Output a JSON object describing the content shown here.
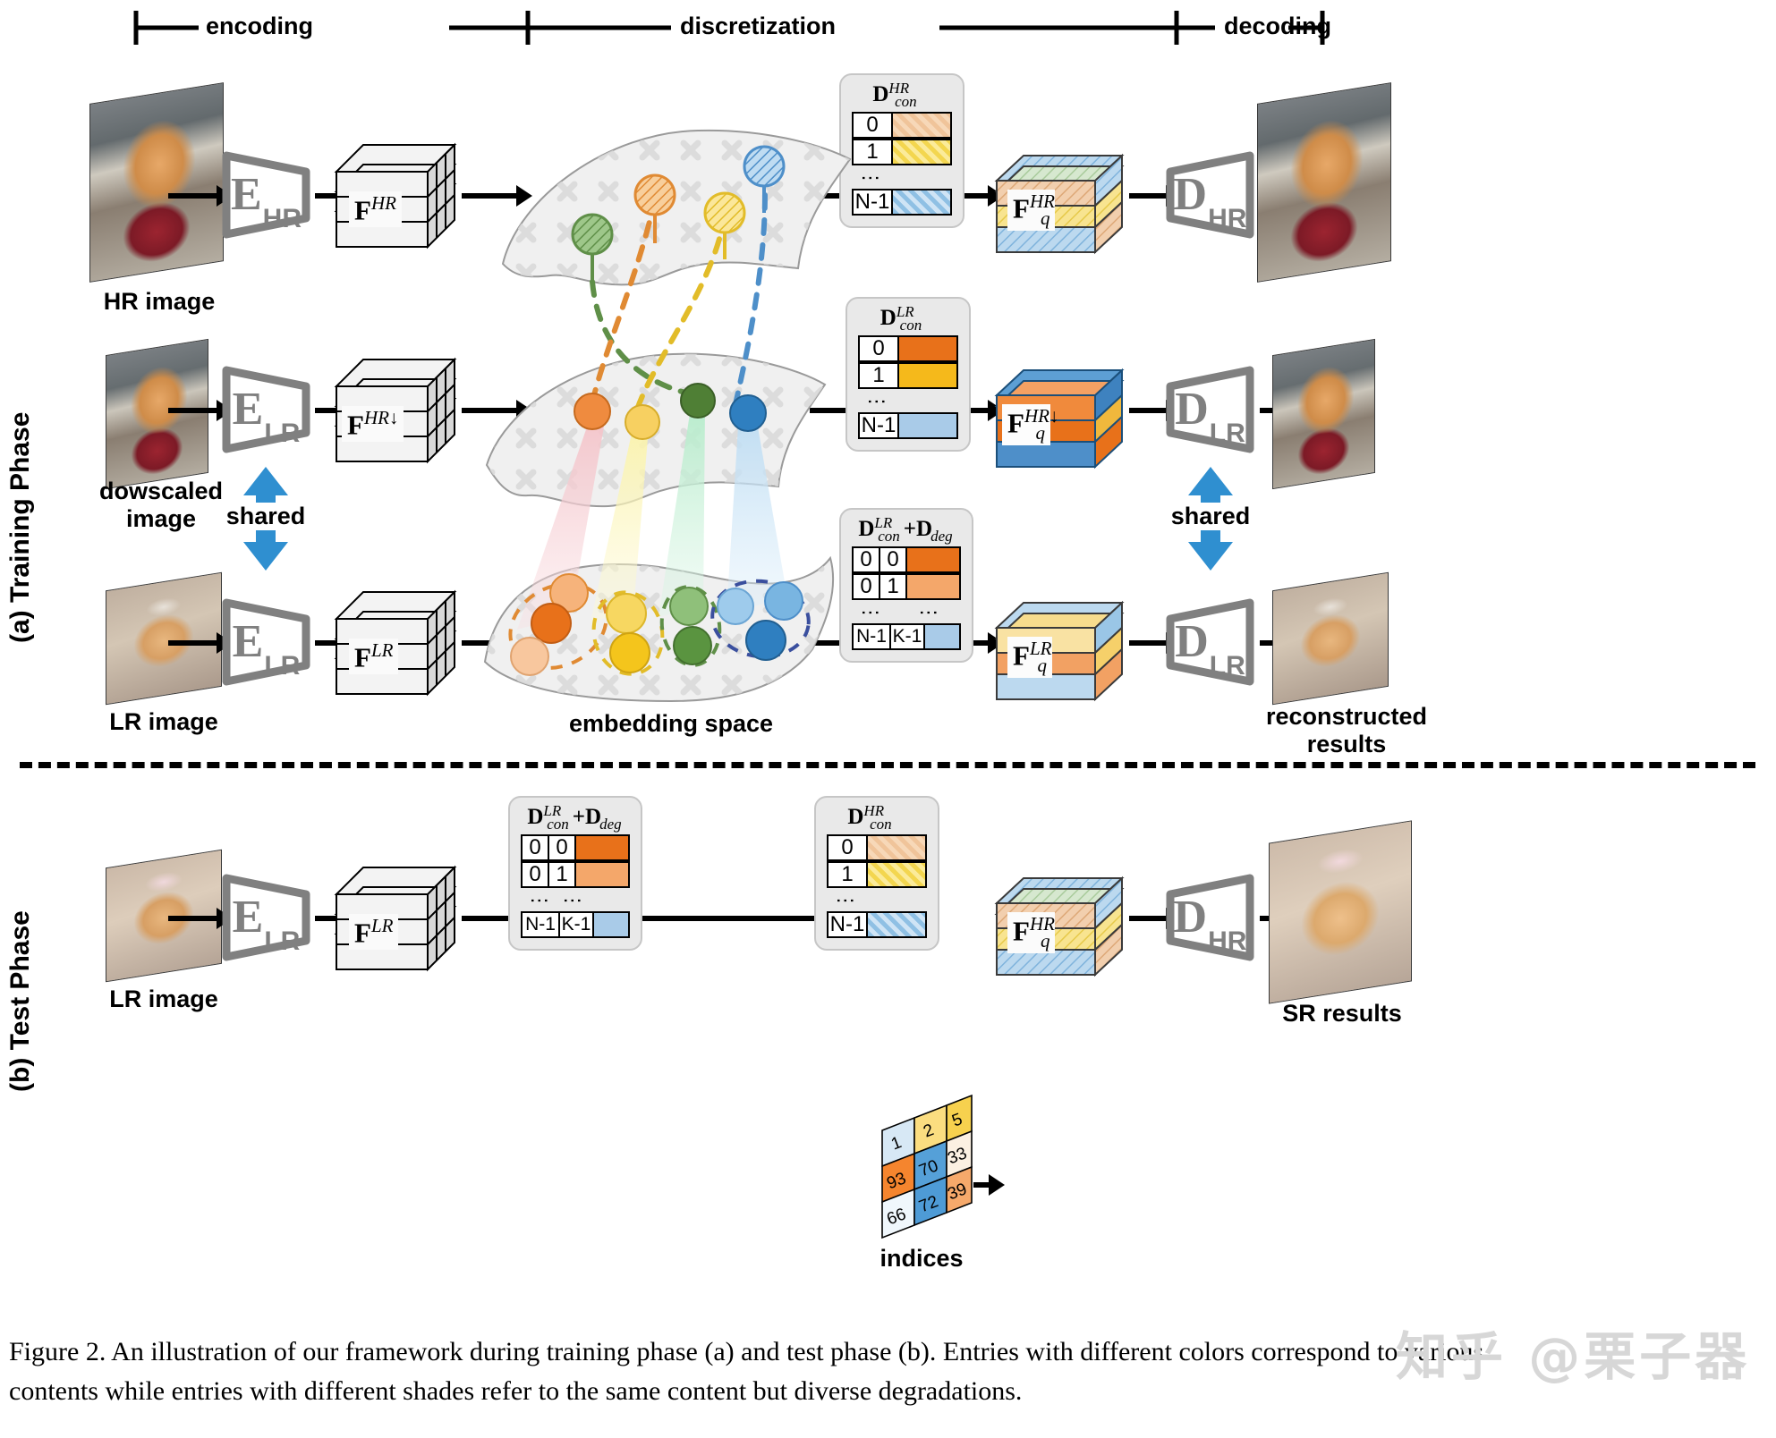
{
  "figure": {
    "caption_line1": "Figure 2. An illustration of our framework during training phase (a) and test phase (b). Entries with different colors correspond to various",
    "caption_line2": "contents while entries with different shades refer to the same content but diverse degradations.",
    "watermark": "知乎 @栗子器"
  },
  "stages": [
    {
      "label": "encoding"
    },
    {
      "label": "discretization"
    },
    {
      "label": "decoding"
    }
  ],
  "phases": [
    {
      "label": "(a) Training Phase"
    },
    {
      "label": "(b) Test Phase"
    }
  ],
  "training": {
    "rows": [
      {
        "input_label": "HR image",
        "encoder": {
          "main": "E",
          "sub": "HR"
        },
        "feature": {
          "base": "F",
          "sup": "HR",
          "sub": ""
        },
        "codebook": {
          "title_main": "D",
          "title_sup": "HR",
          "title_sub": "con",
          "columns": 1,
          "rows": [
            {
              "idx": [
                "0"
              ],
              "color": "#f0c49a",
              "hatched": true
            },
            {
              "idx": [
                "1"
              ],
              "color": "#f7dc63",
              "hatched": true
            }
          ],
          "last_row": {
            "idx": [
              "N-1"
            ],
            "color": "#a9cbe8",
            "hatched": true
          },
          "ellipsis": "⋮"
        },
        "quant_feature": {
          "base": "F",
          "sup": "HR",
          "sub": "q"
        },
        "decoder": {
          "main": "D",
          "sub": "HR"
        },
        "output_label": ""
      },
      {
        "input_label": "dowscaled\nimage",
        "encoder": {
          "main": "E",
          "sub": "LR"
        },
        "feature": {
          "base": "F",
          "sup": "HR↓",
          "sub": ""
        },
        "codebook": {
          "title_main": "D",
          "title_sup": "LR",
          "title_sub": "con",
          "columns": 1,
          "rows": [
            {
              "idx": [
                "0"
              ],
              "color": "#e8711a",
              "hatched": false
            },
            {
              "idx": [
                "1"
              ],
              "color": "#f5b91b",
              "hatched": false
            }
          ],
          "last_row": {
            "idx": [
              "N-1"
            ],
            "color": "#a9cbe8",
            "hatched": false
          },
          "ellipsis": "⋮"
        },
        "quant_feature": {
          "base": "F",
          "sup": "HR↓",
          "sub": "q"
        },
        "decoder": {
          "main": "D",
          "sub": "LR"
        },
        "output_label": ""
      },
      {
        "input_label": "LR image",
        "encoder": {
          "main": "E",
          "sub": "LR"
        },
        "feature": {
          "base": "F",
          "sup": "LR",
          "sub": ""
        },
        "codebook": {
          "title_main": "D",
          "title_sup": "LR",
          "title_sub": "con",
          "title_extra": "+D",
          "title_extra_sub": "deg",
          "columns": 2,
          "rows": [
            {
              "idx": [
                "0",
                "0"
              ],
              "color": "#e8711a",
              "hatched": false
            },
            {
              "idx": [
                "0",
                "1"
              ],
              "color": "#f2a濃",
              "hatched": false
            }
          ],
          "last_row": {
            "idx": [
              "N-1",
              "K-1"
            ],
            "color": "#a9cbe8",
            "hatched": false
          },
          "ellipsis": "⋮"
        },
        "quant_feature": {
          "base": "F",
          "sup": "LR",
          "sub": "q"
        },
        "decoder": {
          "main": "D",
          "sub": "LR"
        },
        "output_label": "reconstructed\nresults"
      }
    ],
    "shared_label_left": "shared",
    "shared_label_right": "shared",
    "embedding_label": "embedding space"
  },
  "test": {
    "input_label": "LR image",
    "encoder": {
      "main": "E",
      "sub": "LR"
    },
    "feature": {
      "base": "F",
      "sup": "LR",
      "sub": ""
    },
    "codebook_left": {
      "title_main": "D",
      "title_sup": "LR",
      "title_sub": "con",
      "title_extra": "+D",
      "title_extra_sub": "deg",
      "columns": 2,
      "rows": [
        {
          "idx": [
            "0",
            "0"
          ],
          "color": "#e8711a"
        },
        {
          "idx": [
            "0",
            "1"
          ],
          "color": "#f4a76a"
        }
      ],
      "last_row": {
        "idx": [
          "N-1",
          "K-1"
        ],
        "color": "#a9cbe8"
      },
      "ellipsis": "⋮"
    },
    "indices_label": "indices",
    "indices": {
      "values": [
        [
          1,
          2,
          5
        ],
        [
          93,
          70,
          33
        ],
        [
          66,
          72,
          39
        ]
      ],
      "colors": [
        [
          "#d7e8f5",
          "#fbdd80",
          "#f7d14e"
        ],
        [
          "#f5852e",
          "#55a0d8",
          "#fbf0e2"
        ],
        [
          "#f0f7fc",
          "#4e9bd6",
          "#f6a96b"
        ]
      ]
    },
    "codebook_right": {
      "title_main": "D",
      "title_sup": "HR",
      "title_sub": "con",
      "columns": 1,
      "rows": [
        {
          "idx": [
            "0"
          ],
          "color": "#f0c49a",
          "hatched": true
        },
        {
          "idx": [
            "1"
          ],
          "color": "#f7dc63",
          "hatched": true
        }
      ],
      "last_row": {
        "idx": [
          "N-1"
        ],
        "color": "#a9cbe8",
        "hatched": true
      },
      "ellipsis": "⋮"
    },
    "quant_feature": {
      "base": "F",
      "sup": "HR",
      "sub": "q"
    },
    "decoder": {
      "main": "D",
      "sub": "HR"
    },
    "output_label": "SR results"
  },
  "colors": {
    "orange_dark": "#e8711a",
    "orange_light": "#f4a76a",
    "yellow": "#f5b91b",
    "yellow_light": "#f7dc63",
    "blue": "#4e9bd6",
    "blue_light": "#a9cbe8",
    "green": "#6aa84f",
    "grey_icon": "#808080",
    "manifold": "#f0f0f0",
    "arrow_blue": "#2f8fd0"
  }
}
